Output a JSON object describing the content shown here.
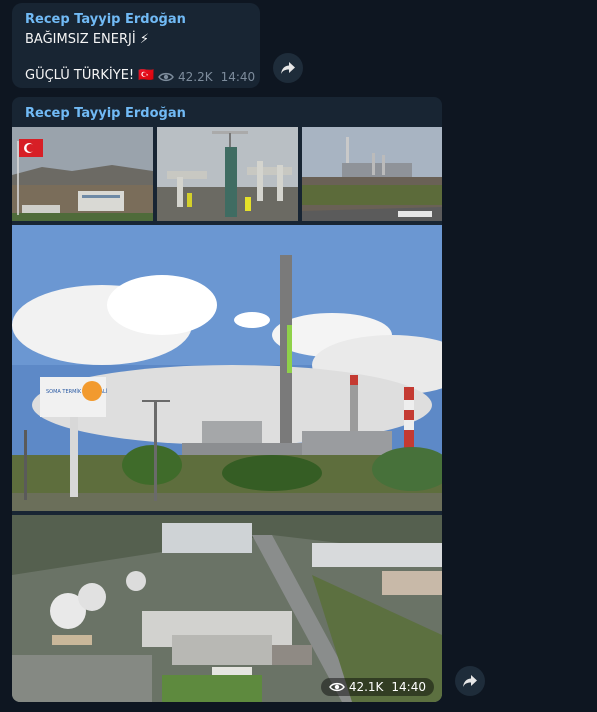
{
  "message1": {
    "author": "Recep Tayyip Erdoğan",
    "line1": "BAĞIMSIZ ENERJİ ⚡",
    "line2": "GÜÇLÜ TÜRKİYE! 🇹🇷",
    "views": "42.2K",
    "time": "14:40"
  },
  "message2": {
    "author": "Recep Tayyip Erdoğan",
    "views": "42.1K",
    "time": "14:40",
    "billboard_text": "SOMA TERMİK SANTRALİ"
  },
  "icons": {
    "views": "eye-icon",
    "share": "share-arrow-icon"
  },
  "colors": {
    "background": "#0e1621",
    "bubble": "#182533",
    "author": "#71baf5"
  }
}
